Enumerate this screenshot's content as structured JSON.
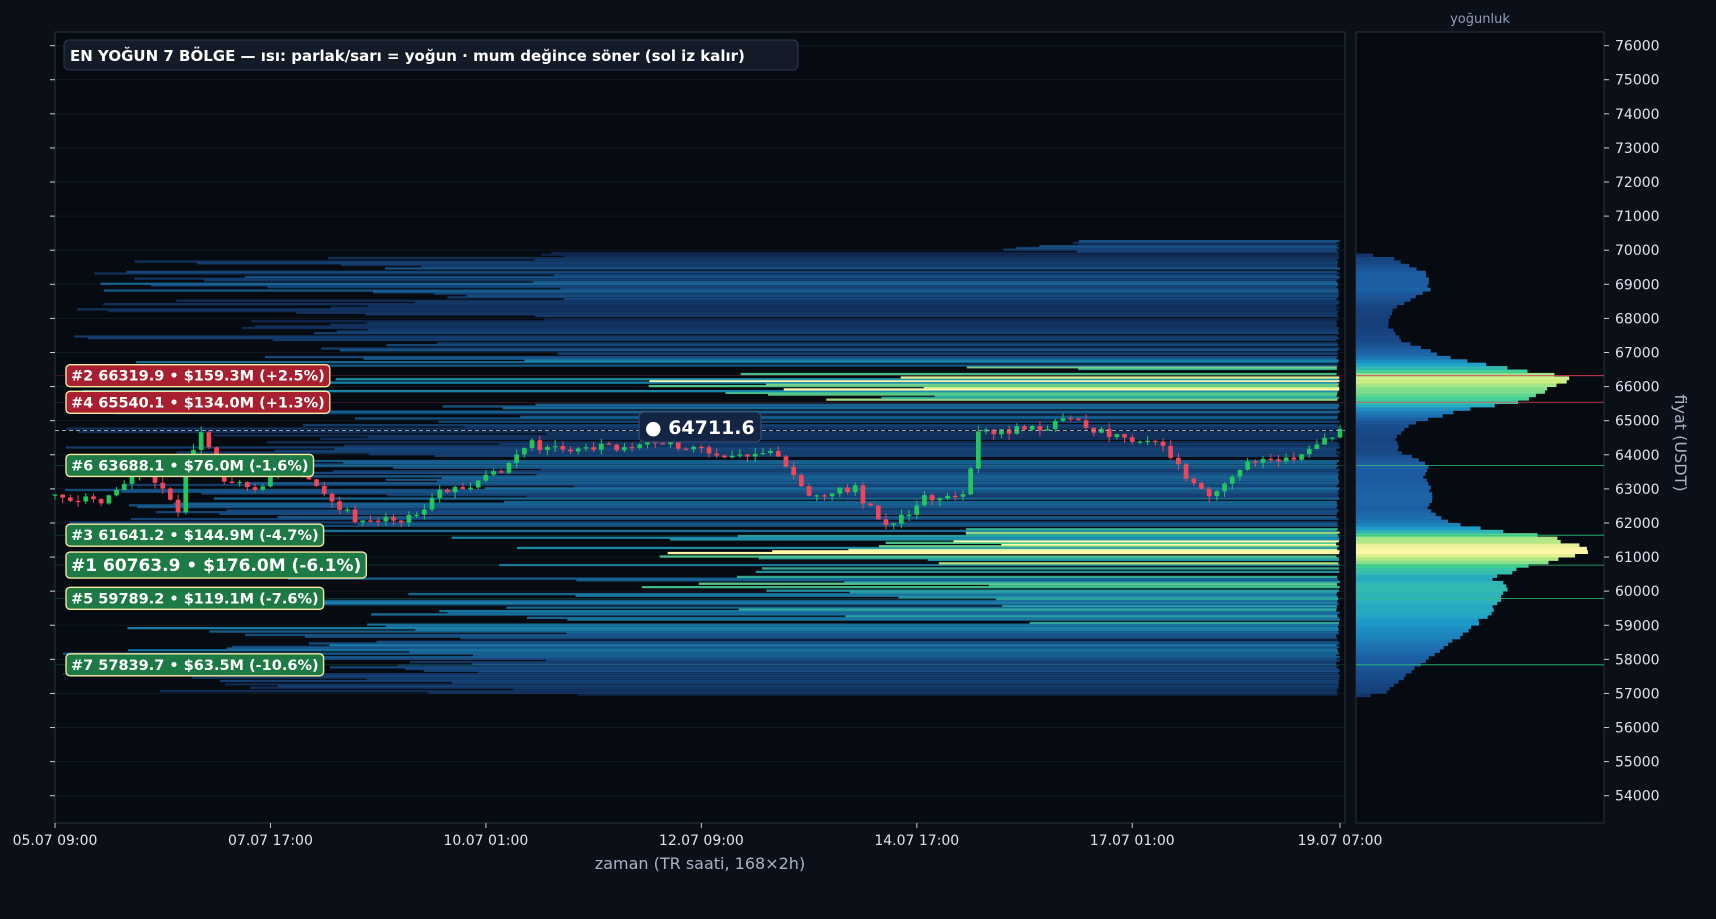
{
  "colors": {
    "background": "#0b0f17",
    "panel": "#060a11",
    "candle_up": "#22c55e",
    "candle_down": "#f0455a",
    "zone_up": "#1d7a45",
    "zone_down": "#a8202f",
    "zone_border": "#f7e9a0",
    "heat_low": "#142a5c",
    "heat_mid": "#1fa0d0",
    "heat_high": "#50d890",
    "heat_top": "#fff7a8"
  },
  "chart_data": {
    "type": "candlestick",
    "title": "EN YOĞUN 7 BÖLGE — ısı: parlak/sarı = yoğun · mum değince söner (sol iz kalır)",
    "xlabel": "zaman (TR saati, 168×2h)",
    "ylabel": "fiyat (USDT)",
    "profile_label": "yoğunluk",
    "ylim": [
      53200,
      76400
    ],
    "yticks": [
      54000,
      55000,
      56000,
      57000,
      58000,
      59000,
      60000,
      61000,
      62000,
      63000,
      64000,
      65000,
      66000,
      67000,
      68000,
      69000,
      70000,
      71000,
      72000,
      73000,
      74000,
      75000,
      76000
    ],
    "x_ticks": [
      {
        "label": "05.07 09:00",
        "i": 0
      },
      {
        "label": "07.07 17:00",
        "i": 28
      },
      {
        "label": "10.07 01:00",
        "i": 56
      },
      {
        "label": "12.07 09:00",
        "i": 84
      },
      {
        "label": "14.07 17:00",
        "i": 112
      },
      {
        "label": "17.07 01:00",
        "i": 140
      },
      {
        "label": "19.07 07:00",
        "i": 167
      }
    ],
    "n_candles": 168,
    "current_price": 64711.6,
    "current_price_label": "● 64711.6",
    "close_path": [
      [
        0,
        62800
      ],
      [
        6,
        62700
      ],
      [
        8,
        63000
      ],
      [
        12,
        63600
      ],
      [
        15,
        62700
      ],
      [
        16,
        62200
      ],
      [
        17,
        63800
      ],
      [
        19,
        64600
      ],
      [
        22,
        63300
      ],
      [
        26,
        63000
      ],
      [
        30,
        63700
      ],
      [
        34,
        63000
      ],
      [
        38,
        62300
      ],
      [
        40,
        62000
      ],
      [
        44,
        62100
      ],
      [
        47,
        62200
      ],
      [
        50,
        62900
      ],
      [
        54,
        63000
      ],
      [
        58,
        63600
      ],
      [
        62,
        64300
      ],
      [
        66,
        64100
      ],
      [
        70,
        64200
      ],
      [
        75,
        64300
      ],
      [
        80,
        64350
      ],
      [
        84,
        64100
      ],
      [
        88,
        64000
      ],
      [
        92,
        64100
      ],
      [
        94,
        64000
      ],
      [
        96,
        63500
      ],
      [
        98,
        62700
      ],
      [
        101,
        62900
      ],
      [
        104,
        63000
      ],
      [
        106,
        62400
      ],
      [
        108,
        62000
      ],
      [
        110,
        62200
      ],
      [
        113,
        62700
      ],
      [
        118,
        62800
      ],
      [
        120,
        64600
      ],
      [
        124,
        64700
      ],
      [
        128,
        64800
      ],
      [
        132,
        65000
      ],
      [
        136,
        64700
      ],
      [
        140,
        64500
      ],
      [
        144,
        64200
      ],
      [
        146,
        63600
      ],
      [
        148,
        63200
      ],
      [
        150,
        62700
      ],
      [
        152,
        63100
      ],
      [
        154,
        63600
      ],
      [
        157,
        64000
      ],
      [
        160,
        63900
      ],
      [
        164,
        64200
      ],
      [
        167,
        64711.6
      ]
    ],
    "profile_anchors": [
      [
        56900,
        0
      ],
      [
        57000,
        0.12
      ],
      [
        57500,
        0.2
      ],
      [
        58000,
        0.29
      ],
      [
        58500,
        0.4
      ],
      [
        59000,
        0.5
      ],
      [
        59500,
        0.58
      ],
      [
        60000,
        0.62
      ],
      [
        60400,
        0.57
      ],
      [
        60800,
        0.74
      ],
      [
        61100,
        0.92
      ],
      [
        61300,
        0.94
      ],
      [
        61600,
        0.78
      ],
      [
        62000,
        0.38
      ],
      [
        62400,
        0.3
      ],
      [
        63000,
        0.31
      ],
      [
        63300,
        0.28
      ],
      [
        63700,
        0.3
      ],
      [
        64100,
        0.18
      ],
      [
        64500,
        0.16
      ],
      [
        64900,
        0.23
      ],
      [
        65300,
        0.42
      ],
      [
        65600,
        0.7
      ],
      [
        66000,
        0.82
      ],
      [
        66300,
        0.87
      ],
      [
        66800,
        0.4
      ],
      [
        67300,
        0.2
      ],
      [
        67800,
        0.13
      ],
      [
        68300,
        0.15
      ],
      [
        68800,
        0.3
      ],
      [
        69300,
        0.3
      ],
      [
        69800,
        0.14
      ],
      [
        69900,
        0
      ]
    ],
    "zones": [
      {
        "rank": 2,
        "price": 66319.9,
        "label": "#2  66319.9  •  $159.3M  (+2.5%)",
        "side": "above",
        "intensity": 0.85
      },
      {
        "rank": 4,
        "price": 65540.1,
        "label": "#4  65540.1  •  $134.0M  (+1.3%)",
        "side": "above",
        "intensity": 0.7
      },
      {
        "rank": 6,
        "price": 63688.1,
        "label": "#6  63688.1  •  $76.0M  (-1.6%)",
        "side": "below",
        "intensity": 0.4
      },
      {
        "rank": 3,
        "price": 61641.2,
        "label": "#3  61641.2  •  $144.9M  (-4.7%)",
        "side": "below",
        "intensity": 0.78
      },
      {
        "rank": 1,
        "price": 60763.9,
        "label": "#1  60763.9  •  $176.0M  (-6.1%)",
        "side": "below",
        "intensity": 1.0
      },
      {
        "rank": 5,
        "price": 59789.2,
        "label": "#5  59789.2  •  $119.1M  (-7.6%)",
        "side": "below",
        "intensity": 0.65
      },
      {
        "rank": 7,
        "price": 57839.7,
        "label": "#7  57839.7  •  $63.5M  (-10.6%)",
        "side": "below",
        "intensity": 0.35
      }
    ]
  }
}
